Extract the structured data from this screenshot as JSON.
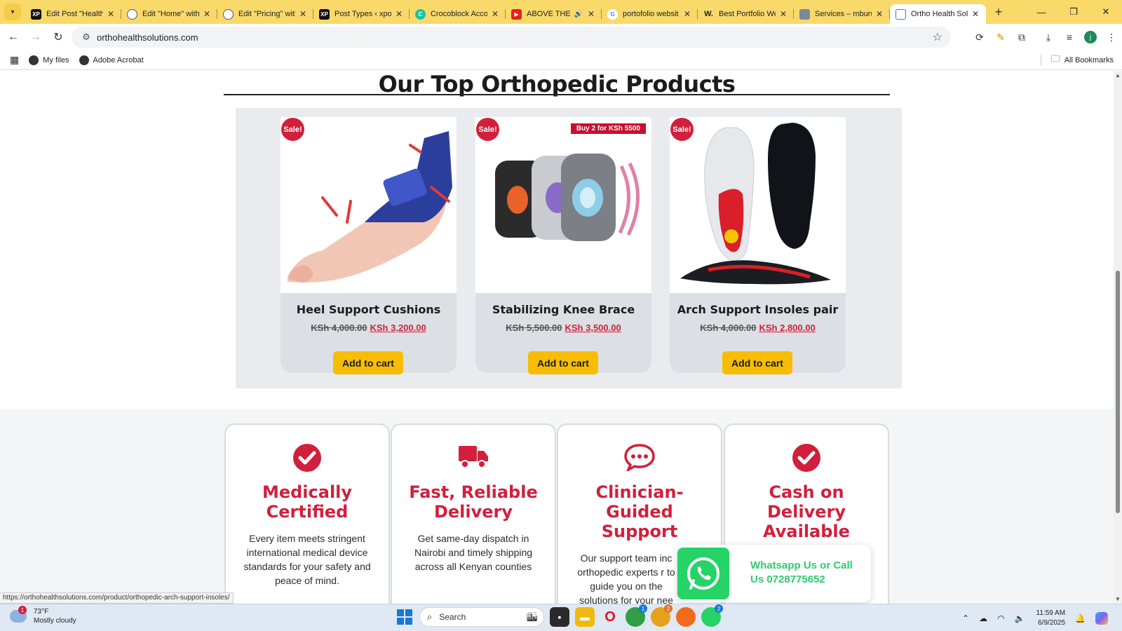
{
  "browser": {
    "tabs": [
      {
        "title": "Edit Post \"Health P",
        "icon_color": "#111111",
        "icon_label": "XP"
      },
      {
        "title": "Edit \"Home\" with",
        "icon_color": "#555555",
        "icon_label": ""
      },
      {
        "title": "Edit \"Pricing\" with",
        "icon_color": "#555555",
        "icon_label": ""
      },
      {
        "title": "Post Types ‹ xport",
        "icon_color": "#111111",
        "icon_label": "XP"
      },
      {
        "title": "Crocoblock Accou",
        "icon_color": "#18c3a6",
        "icon_label": "C"
      },
      {
        "title": "ABOVE THE LI",
        "icon_color": "#e62117",
        "icon_label": "▶"
      },
      {
        "title": "portofolio websit",
        "icon_color": "#4285f4",
        "icon_label": "G"
      },
      {
        "title": "Best Portfolio We",
        "icon_color": "#1b1b1b",
        "icon_label": "W."
      },
      {
        "title": "Services – mburu",
        "icon_color": "#7a8a9a",
        "icon_label": ""
      },
      {
        "title": "Ortho Health Solu",
        "icon_color": "#3a7bd5",
        "icon_label": ""
      }
    ],
    "active_tab_index": 9,
    "url": "orthohealthsolutions.com",
    "bookmarks": [
      {
        "label": "My files"
      },
      {
        "label": "Adobe Acrobat"
      }
    ],
    "all_bookmarks_label": "All Bookmarks",
    "profile_initial": "j",
    "status_url": "https://orthohealthsolutions.com/product/orthopedic-arch-support-insoles/"
  },
  "page": {
    "section_title": "Our Top Orthopedic Products",
    "sale_badge": "Sale!",
    "add_to_cart_label": "Add to cart",
    "products": [
      {
        "name": "Heel Support Cushions",
        "old_price": "KSh 4,000.00",
        "new_price": "KSh 3,200.00",
        "promo": ""
      },
      {
        "name": "Stabilizing Knee Brace",
        "old_price": "KSh 5,500.00",
        "new_price": "KSh 3,500.00",
        "promo": "Buy 2 for KSh 5500"
      },
      {
        "name": "Arch Support Insoles pair",
        "old_price": "KSh 4,000.00",
        "new_price": "KSh 2,800.00",
        "promo": ""
      }
    ],
    "features": [
      {
        "icon": "check-circle-icon",
        "title": "Medically Certified",
        "desc": "Every item meets stringent international medical device standards for your safety and peace of mind."
      },
      {
        "icon": "truck-icon",
        "title": "Fast, Reliable Delivery",
        "desc": "Get same-day dispatch in Nairobi and timely shipping across all Kenyan counties"
      },
      {
        "icon": "chat-icon",
        "title": "Clinician-Guided Support",
        "desc": "Our support team inc orthopedic experts r to guide you on the solutions for your nee"
      },
      {
        "icon": "check-circle-icon",
        "title": "Cash on Delivery Available",
        "desc": ""
      }
    ],
    "whatsapp": {
      "text": "Whatsapp Us or Call Us 0728775652"
    },
    "accent_color": "#d21f3c",
    "button_color": "#f7bd06"
  },
  "taskbar": {
    "weather_temp": "73°F",
    "weather_desc": "Mostly cloudy",
    "weather_badge": "1",
    "search_placeholder": "Search",
    "time": "11:59 AM",
    "date": "6/9/2025",
    "chrome_badge": "1",
    "chrome2_badge": "2",
    "whatsapp_badge": "2"
  }
}
